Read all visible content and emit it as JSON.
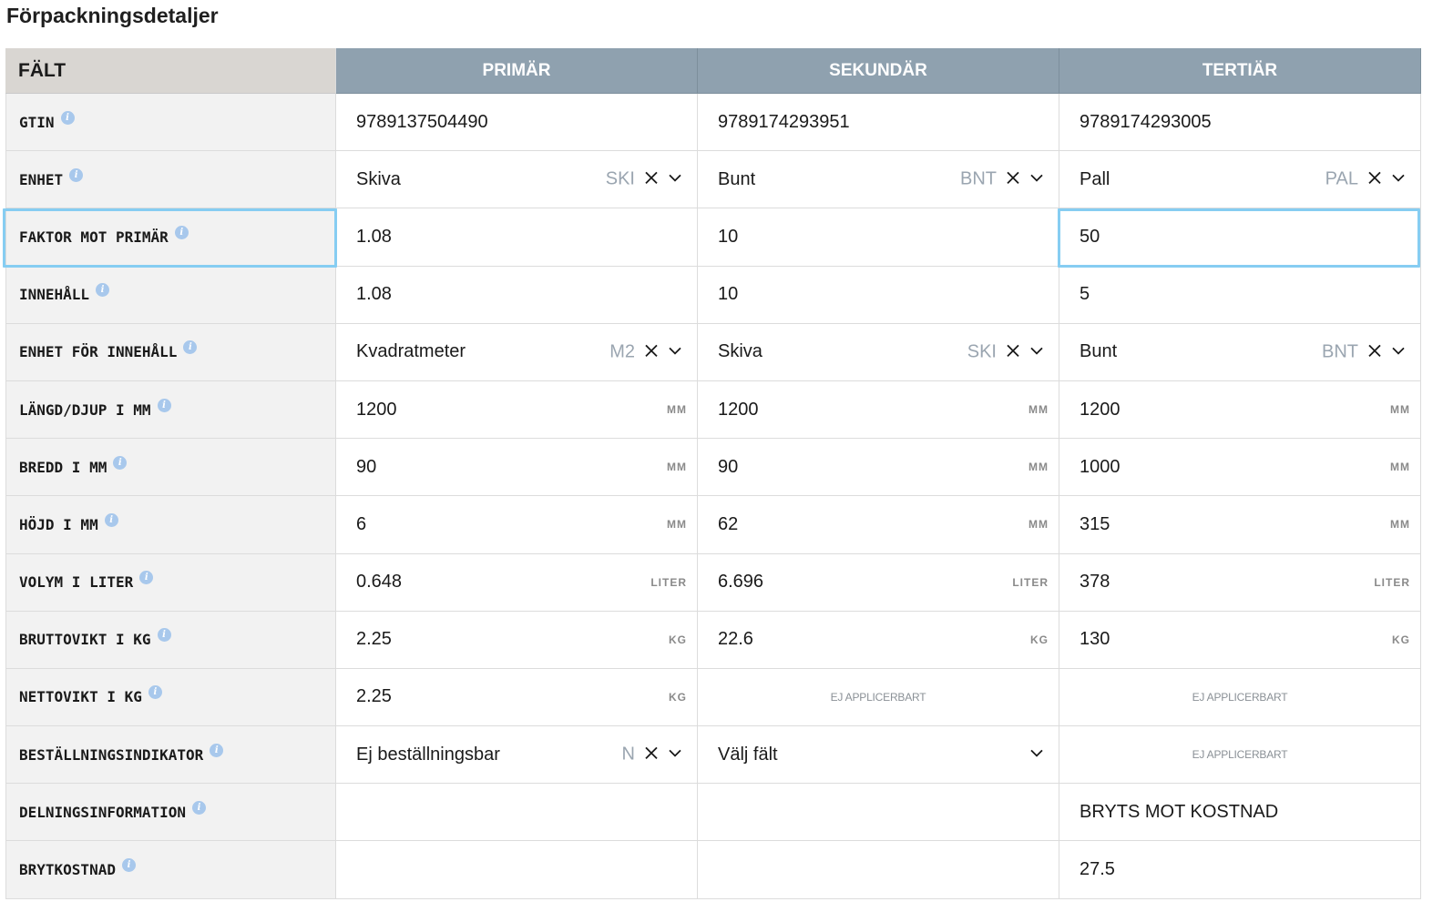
{
  "title": "Förpackningsdetaljer",
  "headers": {
    "field": "FÄLT",
    "primary": "PRIMÄR",
    "secondary": "SEKUNDÄR",
    "tertiary": "TERTIÄR"
  },
  "info_glyph": "i",
  "units": {
    "mm": "MM",
    "liter": "LITER",
    "kg": "KG"
  },
  "not_applicable": "EJ APPLICERBART",
  "rows": {
    "gtin": {
      "label": "GTIN",
      "primary": "9789137504490",
      "secondary": "9789174293951",
      "tertiary": "9789174293005"
    },
    "enhet": {
      "label": "ENHET",
      "primary": {
        "text": "Skiva",
        "code": "SKI"
      },
      "secondary": {
        "text": "Bunt",
        "code": "BNT"
      },
      "tertiary": {
        "text": "Pall",
        "code": "PAL"
      }
    },
    "faktor": {
      "label": "FAKTOR MOT PRIMÄR",
      "primary": "1.08",
      "secondary": "10",
      "tertiary": "50"
    },
    "innehall": {
      "label": "INNEHÅLL",
      "primary": "1.08",
      "secondary": "10",
      "tertiary": "5"
    },
    "enhet_innehall": {
      "label": "ENHET FÖR INNEHÅLL",
      "primary": {
        "text": "Kvadratmeter",
        "code": "M2"
      },
      "secondary": {
        "text": "Skiva",
        "code": "SKI"
      },
      "tertiary": {
        "text": "Bunt",
        "code": "BNT"
      }
    },
    "langd": {
      "label": "LÄNGD/DJUP I MM",
      "primary": "1200",
      "secondary": "1200",
      "tertiary": "1200"
    },
    "bredd": {
      "label": "BREDD I MM",
      "primary": "90",
      "secondary": "90",
      "tertiary": "1000"
    },
    "hojd": {
      "label": "HÖJD I MM",
      "primary": "6",
      "secondary": "62",
      "tertiary": "315"
    },
    "volym": {
      "label": "VOLYM I LITER",
      "primary": "0.648",
      "secondary": "6.696",
      "tertiary": "378"
    },
    "bruttovikt": {
      "label": "BRUTTOVIKT I KG",
      "primary": "2.25",
      "secondary": "22.6",
      "tertiary": "130"
    },
    "nettovikt": {
      "label": "NETTOVIKT I KG",
      "primary": "2.25"
    },
    "bestallning": {
      "label": "BESTÄLLNINGSINDIKATOR",
      "primary": {
        "text": "Ej beställningsbar",
        "code": "N"
      },
      "secondary": {
        "placeholder": "Välj fält"
      }
    },
    "delning": {
      "label": "DELNINGSINFORMATION",
      "tertiary": "BRYTS MOT KOSTNAD"
    },
    "brytkostnad": {
      "label": "BRYTKOSTNAD",
      "tertiary": "27.5"
    }
  },
  "colors": {
    "header_bg": "#8fa1af",
    "field_header_bg": "#d9d6d2",
    "label_bg": "#f2f2f2",
    "focus": "#86cdf2",
    "info": "#a8c8ec"
  }
}
